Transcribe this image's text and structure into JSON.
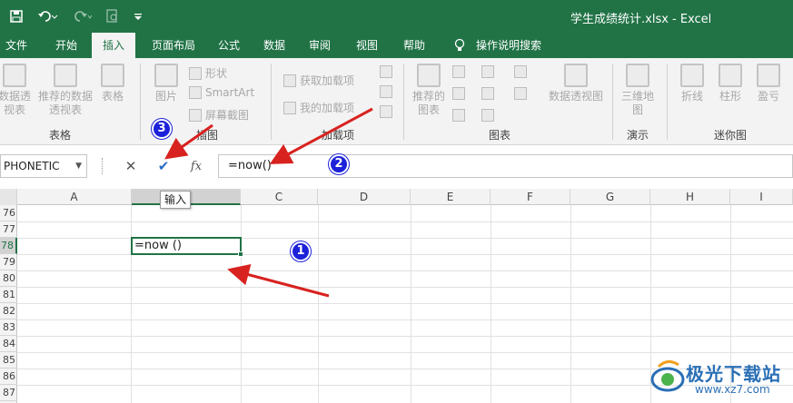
{
  "title_bar": {
    "title": "学生成绩统计.xlsx  -  Excel"
  },
  "tabs": [
    "文件",
    "开始",
    "插入",
    "页面布局",
    "公式",
    "数据",
    "审阅",
    "视图",
    "帮助",
    "操作说明搜索"
  ],
  "active_tab": "插入",
  "ribbon": {
    "groups": {
      "tables": {
        "label": "表格",
        "items": [
          "数据透视表",
          "推荐的数据透视表",
          "表格"
        ]
      },
      "illustrations": {
        "label": "插图",
        "picture": "图片",
        "shapes": "形状",
        "smartart": "SmartArt",
        "screenshot": "屏幕截图"
      },
      "addins": {
        "label": "加载项",
        "get": "获取加载项",
        "mine": "我的加载项"
      },
      "charts": {
        "label": "图表",
        "recommended": "推荐的图表",
        "pivot_chart": "数据透视图"
      },
      "tours": {
        "label": "演示",
        "map3d": "三维地图"
      },
      "sparklines": {
        "label": "迷你图",
        "items": [
          "折线",
          "柱形",
          "盈亏"
        ]
      }
    }
  },
  "formula_bar": {
    "name_box": "PHONETIC",
    "cancel_symbol": "✕",
    "enter_symbol": "✔",
    "fx_symbol": "fx",
    "formula": "=now()"
  },
  "grid": {
    "columns": [
      "A",
      "B",
      "C",
      "D",
      "E",
      "F",
      "G",
      "H",
      "I"
    ],
    "selected_column": "B",
    "rows": [
      "76",
      "77",
      "78",
      "79",
      "80",
      "81",
      "82",
      "83",
      "84",
      "85",
      "86",
      "87"
    ],
    "selected_row": "78",
    "active_cell_value": "=now ()",
    "tooltip": "输入"
  },
  "annotations": [
    "1",
    "2",
    "3"
  ],
  "watermark": {
    "text": "极光下载站",
    "url": "www.xz7.com"
  },
  "colors": {
    "excel_green": "#217346",
    "arrow_red": "#d8221f",
    "badge_blue": "#1c22d9"
  }
}
